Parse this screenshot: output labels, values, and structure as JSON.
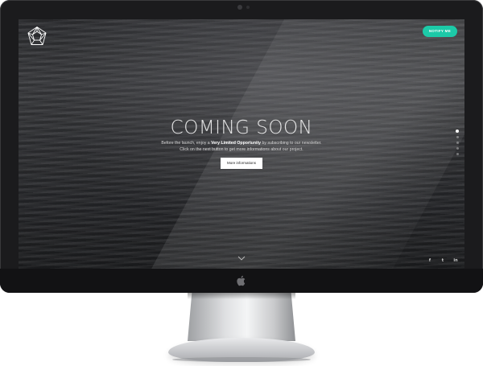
{
  "header": {
    "notify_label": "NOTIFY ME"
  },
  "hero": {
    "title": "COMING SOON",
    "text_line1_before": "Before the launch, enjoy a ",
    "text_line1_highlight": "Very Limited Opportunity",
    "text_line1_after": " by subscribing to our newsletter.",
    "text_line2": "Click on the next button to get more informations about our project.",
    "button_label": "More informations"
  },
  "pagination": {
    "dot_count": 5,
    "active_index": 0
  },
  "social": {
    "facebook": "f",
    "twitter": "t",
    "linkedin": "in"
  },
  "icons": {
    "logo": "geometric-polyhedron-logo",
    "scroll": "chevron-down-icon",
    "brand": "apple-icon"
  },
  "colors": {
    "accent": "#1ccaa8",
    "bezel": "#1b1b1d",
    "button_bg": "#ffffff"
  }
}
